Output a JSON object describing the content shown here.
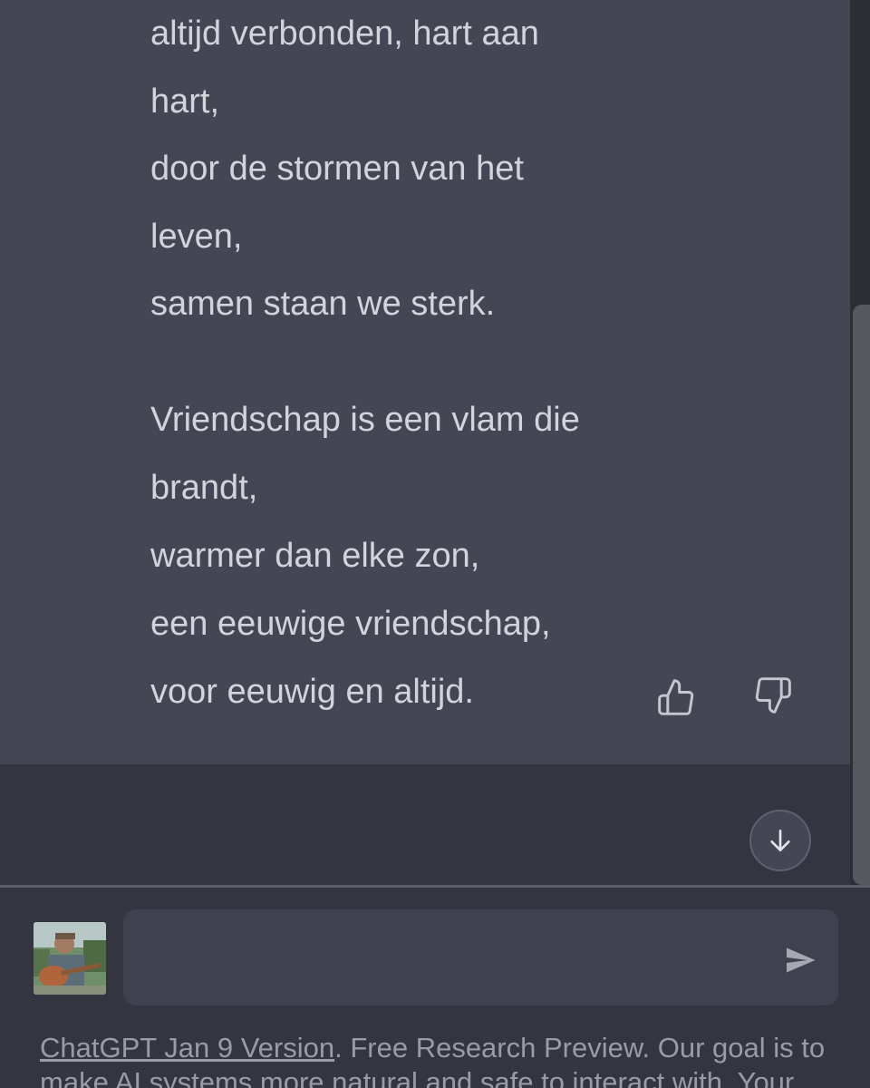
{
  "message": {
    "lines": [
      "altijd verbonden, hart aan",
      "hart,",
      "door de stormen van het",
      "leven,",
      "samen staan we sterk.",
      "Vriendschap is een vlam die",
      "brandt,",
      "warmer dan elke zon,",
      "een eeuwige vriendschap,",
      "voor eeuwig en altijd."
    ],
    "thumbs_up_icon": "thumbs-up-icon",
    "thumbs_down_icon": "thumbs-down-icon"
  },
  "composer": {
    "value": "",
    "placeholder": "",
    "send_icon": "paper-plane-icon"
  },
  "scroll_down_icon": "arrow-down-icon",
  "footer": {
    "link_text": "ChatGPT Jan 9 Version",
    "line1_rest": ". Free Research Preview. Our goal is to",
    "line2": "make AI systems more natural and safe to interact with. Your"
  },
  "colors": {
    "message_bg": "#444654",
    "page_bg": "#343541",
    "composer_bg": "#40414f",
    "text": "#d1d5db",
    "footer_text": "#9a9ba4"
  }
}
